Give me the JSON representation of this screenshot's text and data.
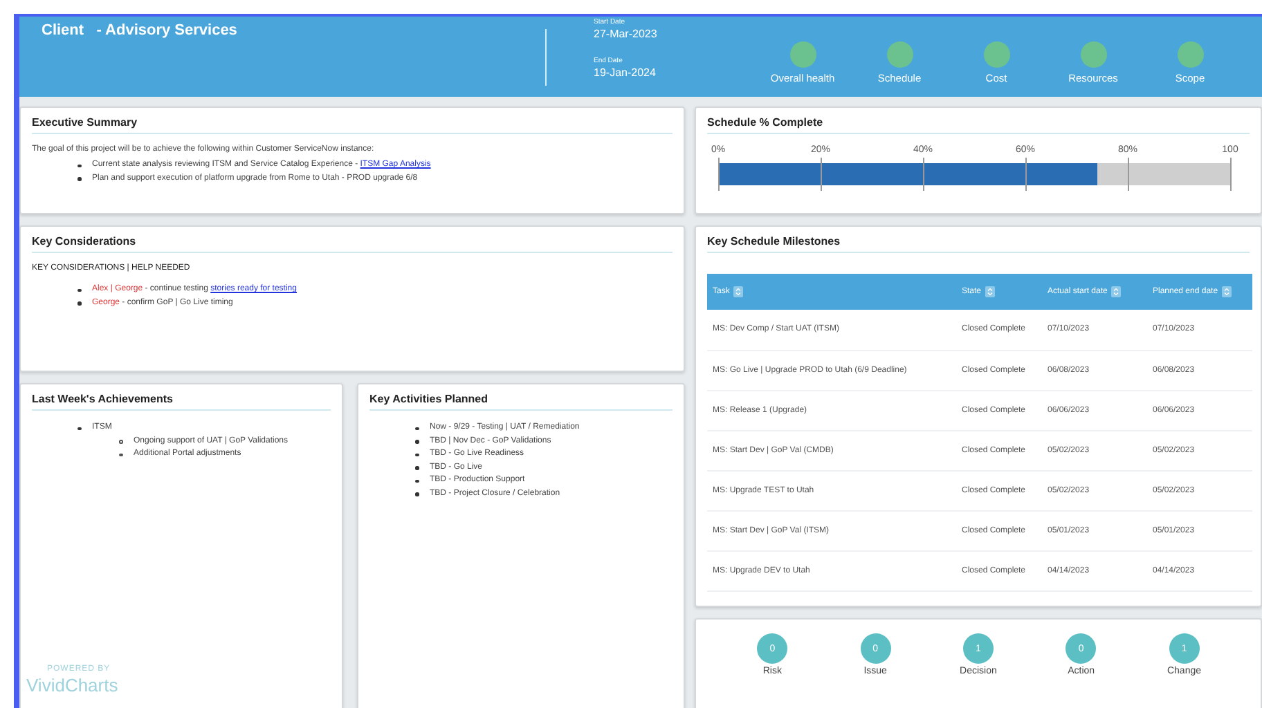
{
  "header": {
    "title": "Client   - Advisory Services",
    "start_date_label": "Start Date",
    "start_date": "27-Mar-2023",
    "end_date_label": "End Date",
    "end_date": "19-Jan-2024",
    "health": [
      {
        "label": "Overall health",
        "color": "#6cc28e"
      },
      {
        "label": "Schedule",
        "color": "#6cc28e"
      },
      {
        "label": "Cost",
        "color": "#6cc28e"
      },
      {
        "label": "Resources",
        "color": "#6cc28e"
      },
      {
        "label": "Scope",
        "color": "#6cc28e"
      }
    ]
  },
  "executive_summary": {
    "title": "Executive Summary",
    "intro": "The goal of this project will be to achieve the following within Customer ServiceNow instance:",
    "bullets": [
      {
        "text": "Current state analysis reviewing ITSM and Service Catalog Experience - ",
        "link": "ITSM Gap Analysis"
      },
      {
        "text": "Plan and support execution of platform upgrade from Rome to Utah - PROD upgrade 6/8"
      }
    ]
  },
  "key_considerations": {
    "title": "Key Considerations",
    "heading": "KEY CONSIDERATIONS | HELP NEEDED",
    "bullets": [
      {
        "who": "Alex | George",
        "text": " - continue testing ",
        "link": "stories ready for testing"
      },
      {
        "who": "George",
        "text": " - confirm GoP | Go Live timing"
      }
    ]
  },
  "last_week": {
    "title": "Last Week's Achievements",
    "items": [
      {
        "text": "ITSM",
        "children": [
          {
            "text": "Ongoing support of UAT | GoP Validations"
          },
          {
            "text": "Additional Portal adjustments"
          }
        ]
      }
    ]
  },
  "planned": {
    "title": "Key Activities Planned",
    "items": [
      "Now - 9/29 - Testing | UAT / Remediation",
      "TBD | Nov Dec - GoP Validations",
      "TBD - Go Live Readiness",
      "TBD - Go Live",
      "TBD - Production Support",
      "TBD - Project Closure / Celebration"
    ]
  },
  "schedule": {
    "title": "Schedule % Complete",
    "level": 0.74,
    "scale_labels": [
      "0%",
      "20%",
      "40%",
      "60%",
      "80%",
      "100"
    ]
  },
  "milestones": {
    "title": "Key Schedule Milestones",
    "columns": [
      "Task",
      "State",
      "Actual start date",
      "Planned end date"
    ],
    "rows": [
      [
        "MS: Dev Comp / Start UAT (ITSM)",
        "Closed Complete",
        "07/10/2023",
        "07/10/2023"
      ],
      [
        "MS: Go Live | Upgrade PROD to Utah (6/9 Deadline)",
        "Closed Complete",
        "06/08/2023",
        "06/08/2023"
      ],
      [
        "MS: Release 1 (Upgrade)",
        "Closed Complete",
        "06/06/2023",
        "06/06/2023"
      ],
      [
        "MS: Start Dev | GoP Val (CMDB)",
        "Closed Complete",
        "05/02/2023",
        "05/02/2023"
      ],
      [
        "MS: Upgrade TEST to Utah",
        "Closed Complete",
        "05/02/2023",
        "05/02/2023"
      ],
      [
        "MS: Start Dev | GoP Val (ITSM)",
        "Closed Complete",
        "05/01/2023",
        "05/01/2023"
      ],
      [
        "MS: Upgrade DEV to Utah",
        "Closed Complete",
        "04/14/2023",
        "04/14/2023"
      ]
    ]
  },
  "counts": [
    {
      "count": "0",
      "label": "Risk"
    },
    {
      "count": "0",
      "label": "Issue"
    },
    {
      "count": "1",
      "label": "Decision"
    },
    {
      "count": "0",
      "label": "Action"
    },
    {
      "count": "1",
      "label": "Change"
    }
  ],
  "branding": {
    "line_1": "POWERED BY",
    "line_2": "VividCharts"
  }
}
